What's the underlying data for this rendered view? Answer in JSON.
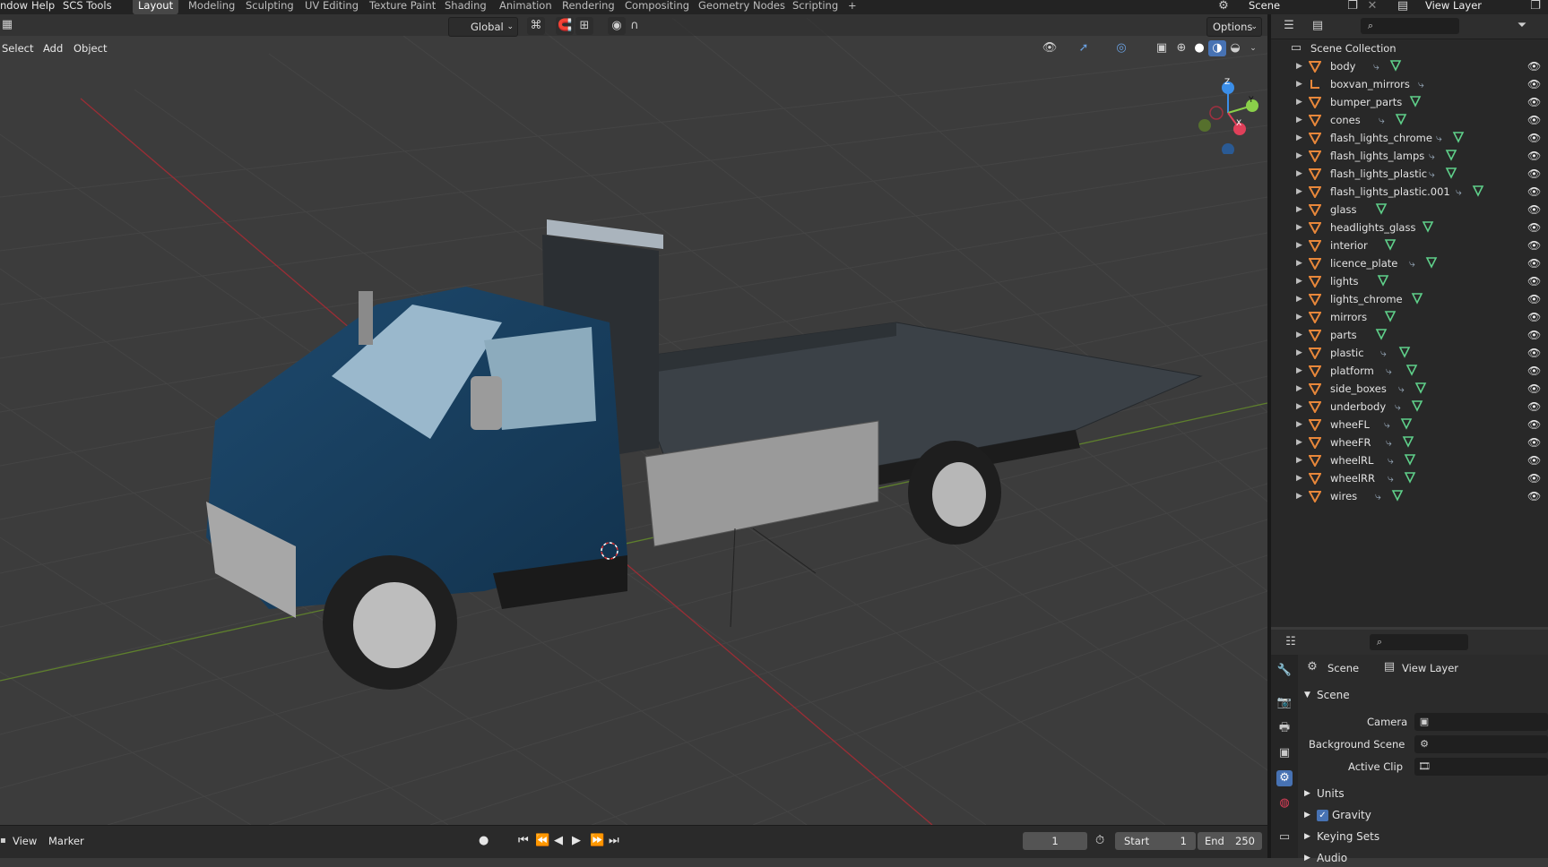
{
  "topbar": {
    "menus": [
      "ndow",
      "Help",
      "SCS Tools"
    ],
    "workspaces": [
      "Layout",
      "Modeling",
      "Sculpting",
      "UV Editing",
      "Texture Paint",
      "Shading",
      "Animation",
      "Rendering",
      "Compositing",
      "Geometry Nodes",
      "Scripting"
    ],
    "add_tab": "+",
    "scene_name": "Scene",
    "view_layer": "View Layer"
  },
  "viewport": {
    "transform_orientation": "Global",
    "options_label": "Options",
    "menu": [
      "Select",
      "Add",
      "Object"
    ],
    "gizmo_axes": {
      "z": "Z",
      "y": "Y",
      "x": "X"
    }
  },
  "outliner": {
    "root": "Scene Collection",
    "items": [
      {
        "name": "body",
        "mod": true
      },
      {
        "name": "boxvan_mirrors",
        "mod": true,
        "type": "empty"
      },
      {
        "name": "bumper_parts",
        "mod": false
      },
      {
        "name": "cones",
        "mod": true
      },
      {
        "name": "flash_lights_chrome",
        "mod": true
      },
      {
        "name": "flash_lights_lamps",
        "mod": true
      },
      {
        "name": "flash_lights_plastic",
        "mod": true
      },
      {
        "name": "flash_lights_plastic.001",
        "mod": true
      },
      {
        "name": "glass",
        "mod": false
      },
      {
        "name": "headlights_glass",
        "mod": false
      },
      {
        "name": "interior",
        "mod": false
      },
      {
        "name": "licence_plate",
        "mod": true
      },
      {
        "name": "lights",
        "mod": false
      },
      {
        "name": "lights_chrome",
        "mod": false
      },
      {
        "name": "mirrors",
        "mod": false
      },
      {
        "name": "parts",
        "mod": false
      },
      {
        "name": "plastic",
        "mod": true
      },
      {
        "name": "platform",
        "mod": true
      },
      {
        "name": "side_boxes",
        "mod": true
      },
      {
        "name": "underbody",
        "mod": true
      },
      {
        "name": "wheeFL",
        "mod": true
      },
      {
        "name": "wheeFR",
        "mod": true
      },
      {
        "name": "wheelRL",
        "mod": true
      },
      {
        "name": "wheelRR",
        "mod": true
      },
      {
        "name": "wires",
        "mod": true
      }
    ]
  },
  "properties": {
    "breadcrumb_scene": "Scene",
    "breadcrumb_view_layer": "View Layer",
    "section_scene": "Scene",
    "camera_label": "Camera",
    "background_scene_label": "Background Scene",
    "active_clip_label": "Active Clip",
    "units_label": "Units",
    "gravity_label": "Gravity",
    "gravity_checked": true,
    "keying_sets_label": "Keying Sets",
    "audio_label": "Audio"
  },
  "timeline": {
    "menu": [
      "View",
      "Marker"
    ],
    "current_frame": "1",
    "start_label": "Start",
    "start_value": "1",
    "end_label": "End",
    "end_value": "250"
  },
  "colors": {
    "accent": "#4772b3",
    "mesh_icon": "#e8873a",
    "modifier_icon": "#6fb6c9",
    "data_icon": "#5fd08a",
    "axis_x": "#e0405a",
    "axis_y": "#8ad04a",
    "axis_z": "#3b8ee8"
  }
}
